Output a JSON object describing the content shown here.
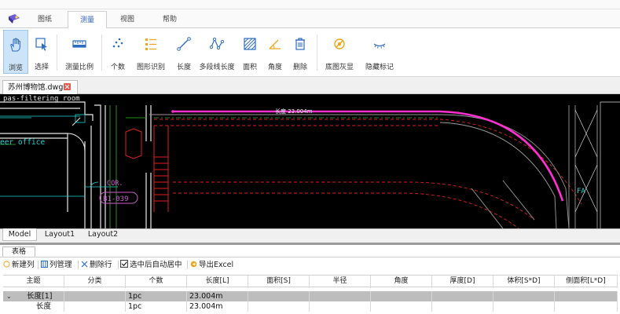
{
  "ribbon_tabs": [
    "图纸",
    "测量",
    "视图",
    "帮助"
  ],
  "ribbon_buttons": [
    {
      "label": "浏览",
      "icon": "hand-icon"
    },
    {
      "label": "选择",
      "icon": "cursor-select-icon"
    },
    {
      "label": "测量比例",
      "icon": "scale-ruler-icon"
    },
    {
      "label": "个数",
      "icon": "count-dots-icon"
    },
    {
      "label": "图形识别",
      "icon": "shape-recognition-icon"
    },
    {
      "label": "长度",
      "icon": "length-line-icon"
    },
    {
      "label": "多段线长度",
      "icon": "polyline-length-icon"
    },
    {
      "label": "面积",
      "icon": "area-hatch-icon"
    },
    {
      "label": "角度",
      "icon": "angle-icon"
    },
    {
      "label": "删除",
      "icon": "trash-icon"
    },
    {
      "label": "底图灰显",
      "icon": "gray-base-icon"
    },
    {
      "label": "隐藏标记",
      "icon": "hide-marks-icon"
    }
  ],
  "file_tab": {
    "name": "苏州博物馆.dwg"
  },
  "drawing": {
    "label_room": "pas-filtering room",
    "label_office": "eer office",
    "label_cor": "COR.",
    "label_room_id": "B1-039",
    "label_fa": "FA",
    "measure_label": "长度 23.004m"
  },
  "layout_tabs": [
    "Model",
    "Layout1",
    "Layout2"
  ],
  "panel": {
    "title": "表格",
    "tools": {
      "new_col": "新建列",
      "col_manage": "列管理",
      "delete_row": "删除行",
      "auto_center": "选中后自动居中",
      "export_excel": "导出Excel"
    },
    "auto_center_checked": true,
    "columns": [
      "主题",
      "分类",
      "个数",
      "长度[L]",
      "面积[S]",
      "半径",
      "角度",
      "厚度[D]",
      "体积[S*D]",
      "侧面积[L*D]"
    ],
    "rows": [
      {
        "subject": "长度[1]",
        "category": "",
        "count": "1pc",
        "length": "23.004m",
        "expanded": true
      },
      {
        "subject": "长度",
        "category": "",
        "count": "1pc",
        "length": "23.004m"
      }
    ]
  },
  "colors": {
    "accent": "#2d5db0",
    "measure_line": "#ff2fd1",
    "canvas": "#000000",
    "wall_red": "#e0201c",
    "cad_cyan": "#1fd5d5",
    "cad_green": "#2fb52f"
  }
}
